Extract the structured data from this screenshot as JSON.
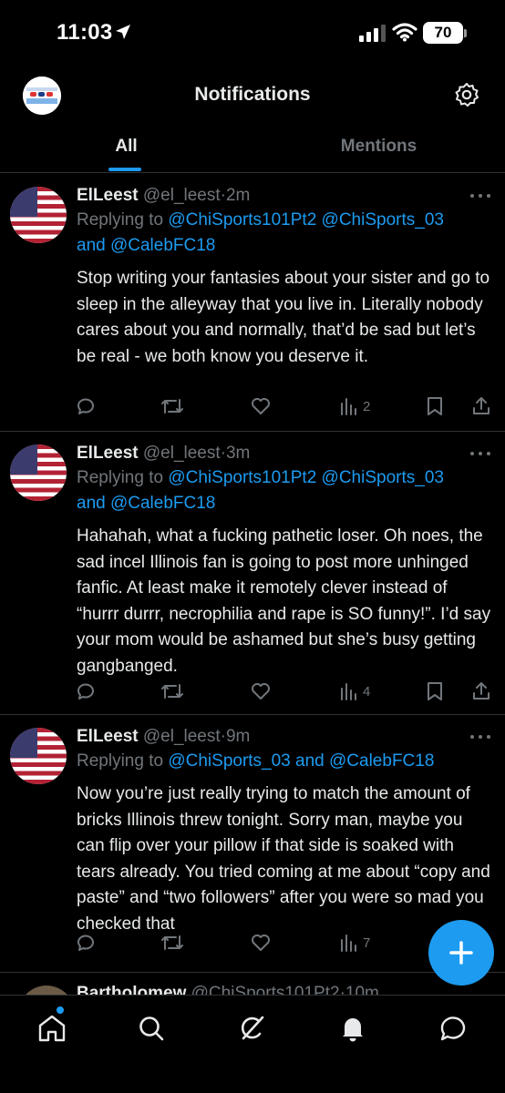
{
  "status_bar": {
    "time": "11:03",
    "battery": "70"
  },
  "header": {
    "title": "Notifications"
  },
  "tabs": [
    {
      "label": "All",
      "active": true
    },
    {
      "label": "Mentions",
      "active": false
    }
  ],
  "tweets": [
    {
      "name": "ElLeest",
      "handle": "@el_leest",
      "time": "2m",
      "replying_prefix": "Replying to",
      "mentions_line1": "@ChiSports101Pt2 @ChiSports_03",
      "mentions_line2": "and @CalebFC18",
      "text": "Stop writing your fantasies about your sister and go to sleep in the alleyway that you live in. Literally nobody cares about you and normally, that’d be sad but let’s be real - we both know you deserve it.",
      "views": "2"
    },
    {
      "name": "ElLeest",
      "handle": "@el_leest",
      "time": "3m",
      "replying_prefix": "Replying to",
      "mentions_line1": "@ChiSports101Pt2 @ChiSports_03",
      "mentions_line2": "and @CalebFC18",
      "text": "Hahahah, what a fucking pathetic loser.  Oh noes, the sad incel Illinois fan is going to post more unhinged fanfic. At least make it remotely clever instead of “hurrr durrr, necrophilia and rape is SO funny!”.  I’d say your mom would be ashamed but she’s busy getting gangbanged.",
      "views": "4"
    },
    {
      "name": "ElLeest",
      "handle": "@el_leest",
      "time": "9m",
      "replying_prefix": "Replying to",
      "mentions_line1": "@ChiSports_03 and @CalebFC18",
      "mentions_line2": "",
      "text": "Now you’re just really trying to match the amount of bricks Illinois threw tonight.  Sorry man, maybe you can flip over your pillow if that side is soaked with tears already.  You tried coming at me about “copy and paste” and “two followers” after you were so mad you checked that",
      "views": "7"
    }
  ],
  "partial_tweet": {
    "name": "Bartholomew",
    "handle": "@ChiSports101Pt2",
    "time": "10m"
  },
  "colors": {
    "accent": "#1d9bf0",
    "muted": "#71767b",
    "text": "#e7e9ea",
    "divider": "#2f3336"
  },
  "icons": [
    "location-arrow-icon",
    "signal-icon",
    "wifi-icon",
    "gear-icon",
    "more-icon",
    "reply-icon",
    "retweet-icon",
    "like-icon",
    "views-icon",
    "bookmark-icon",
    "share-icon",
    "compose-icon",
    "home-icon",
    "search-icon",
    "grok-icon",
    "bell-icon",
    "messages-icon"
  ]
}
